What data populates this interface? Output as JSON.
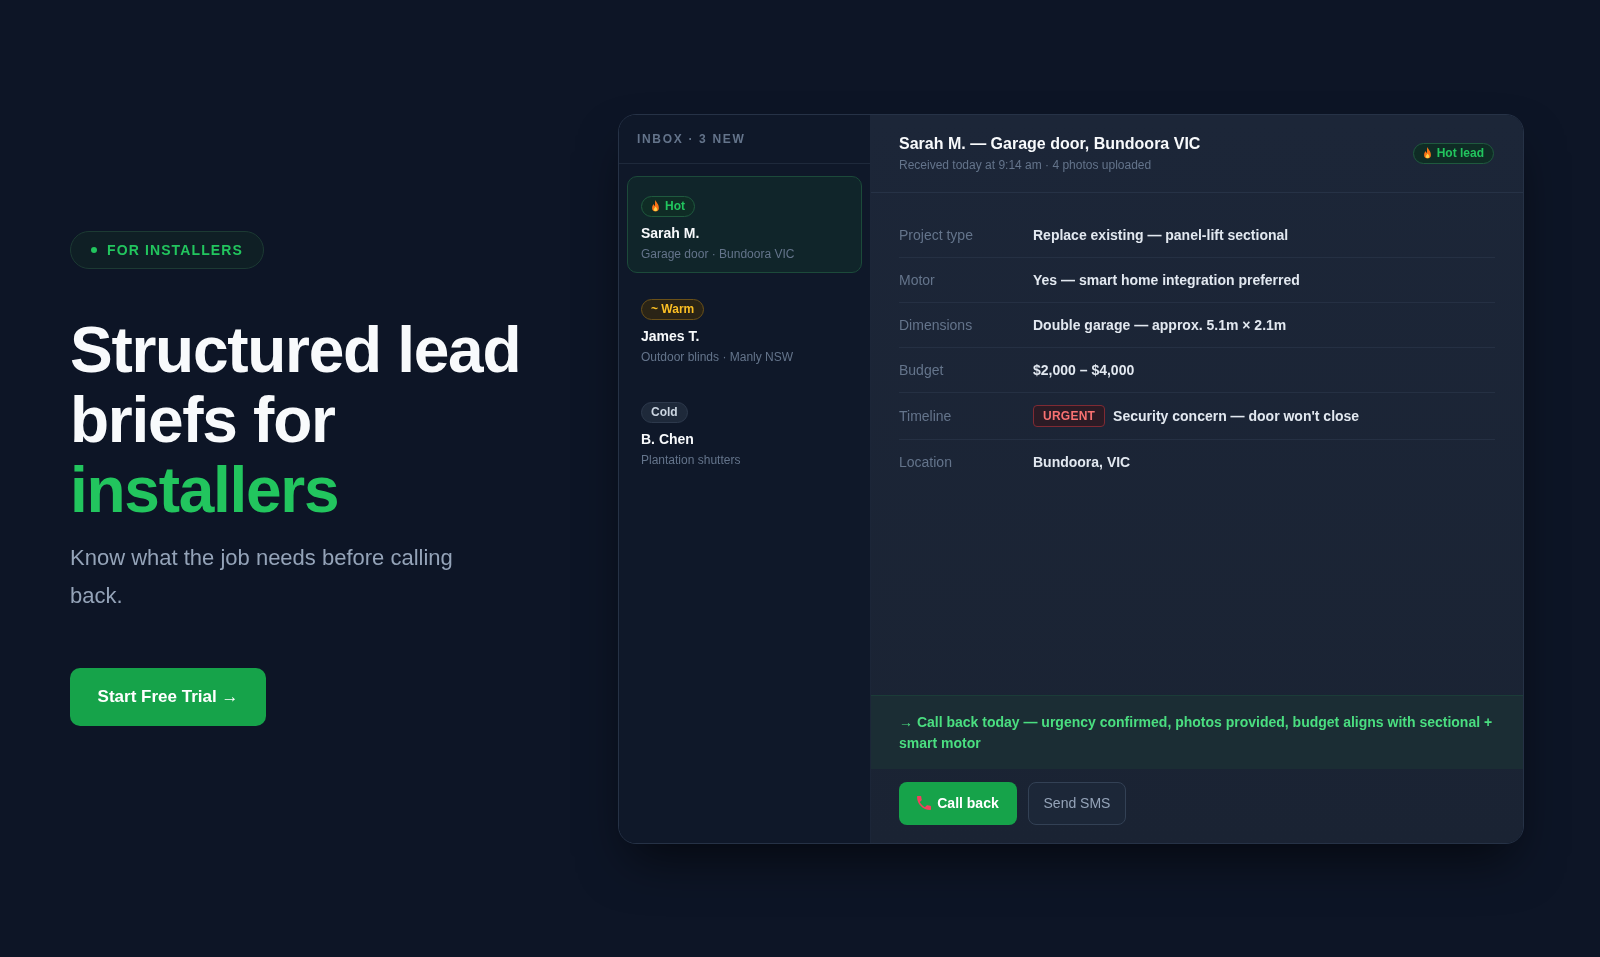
{
  "hero": {
    "eyebrow": "FOR INSTALLERS",
    "headline": [
      {
        "text": "Structured lead briefs for",
        "accent": false
      },
      {
        "text": "installers",
        "accent": true
      }
    ],
    "subtitle": "Know what the job needs before calling back.",
    "cta": "Start Free Trial →"
  },
  "inbox": {
    "header": "INBOX · 3 NEW",
    "leads": [
      {
        "tag": {
          "kind": "hot",
          "label": "Hot"
        },
        "name": "Sarah M.",
        "summary": "Garage door · Bundoora VIC",
        "selected": true
      },
      {
        "tag": {
          "kind": "warm",
          "label": "~ Warm"
        },
        "name": "James T.",
        "summary": "Outdoor blinds · Manly NSW",
        "selected": false
      },
      {
        "tag": {
          "kind": "cold",
          "label": "Cold"
        },
        "name": "B. Chen",
        "summary": "Plantation shutters",
        "selected": false
      }
    ]
  },
  "detail": {
    "title": "Sarah M. — Garage door, Bundoora VIC",
    "meta": "Received today at 9:14 am · 4 photos uploaded",
    "tag": {
      "kind": "hot",
      "label": "Hot lead"
    },
    "fields": [
      {
        "label": "Project type",
        "value": "Replace existing — panel-lift sectional"
      },
      {
        "label": "Motor",
        "value": "Yes — smart home integration preferred"
      },
      {
        "label": "Dimensions",
        "value": "Double garage — approx. 5.1m × 2.1m"
      },
      {
        "label": "Budget",
        "value": "$2,000 – $4,000"
      },
      {
        "label": "Timeline",
        "tag": "URGENT",
        "value": "Security concern — door won't close"
      },
      {
        "label": "Location",
        "value": "Bundoora, VIC"
      }
    ],
    "recommendation": "→ Call back today — urgency confirmed, photos provided, budget aligns with sectional + smart motor",
    "actions": [
      {
        "kind": "call",
        "label": "Call back"
      },
      {
        "kind": "sms",
        "label": "Send SMS"
      }
    ]
  }
}
